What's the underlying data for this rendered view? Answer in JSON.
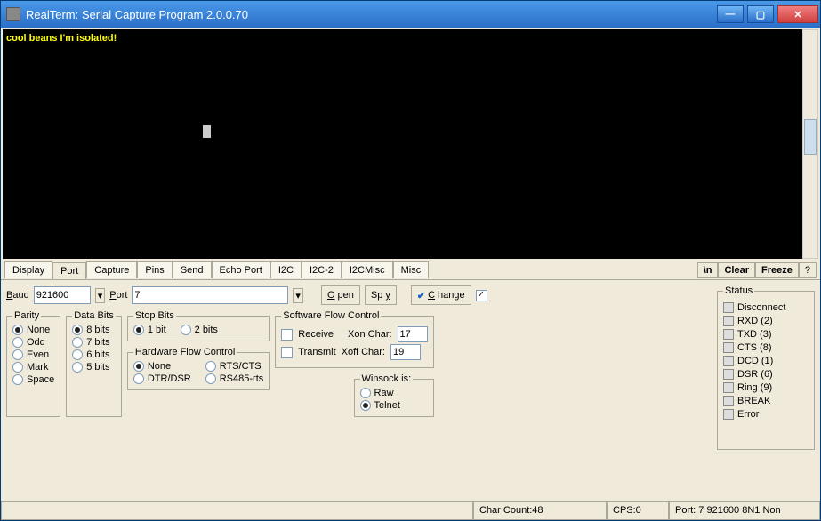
{
  "window": {
    "title": "RealTerm: Serial Capture Program 2.0.0.70"
  },
  "terminal": {
    "text": "cool beans I'm isolated!"
  },
  "tabs": [
    "Display",
    "Port",
    "Capture",
    "Pins",
    "Send",
    "Echo Port",
    "I2C",
    "I2C-2",
    "I2CMisc",
    "Misc"
  ],
  "active_tab": "Port",
  "right_buttons": {
    "nl": "\\n",
    "clear": "Clear",
    "freeze": "Freeze",
    "help": "?"
  },
  "port": {
    "baud_label": "Baud",
    "baud_value": "921600",
    "port_label": "Port",
    "port_value": "7",
    "open": "Open",
    "spy": "Spy",
    "change": "Change"
  },
  "parity": {
    "legend": "Parity",
    "options": [
      "None",
      "Odd",
      "Even",
      "Mark",
      "Space"
    ],
    "selected": "None"
  },
  "databits": {
    "legend": "Data Bits",
    "options": [
      "8 bits",
      "7 bits",
      "6 bits",
      "5 bits"
    ],
    "selected": "8 bits"
  },
  "stopbits": {
    "legend": "Stop Bits",
    "options": [
      "1 bit",
      "2 bits"
    ],
    "selected": "1 bit"
  },
  "hwflow": {
    "legend": "Hardware Flow Control",
    "options": [
      "None",
      "RTS/CTS",
      "DTR/DSR",
      "RS485-rts"
    ],
    "selected": "None"
  },
  "swflow": {
    "legend": "Software Flow Control",
    "receive_label": "Receive",
    "xon_label": "Xon Char:",
    "xon_value": "17",
    "transmit_label": "Transmit",
    "xoff_label": "Xoff Char:",
    "xoff_value": "19"
  },
  "winsock": {
    "legend": "Winsock is:",
    "options": [
      "Raw",
      "Telnet"
    ],
    "selected": "Telnet"
  },
  "status": {
    "legend": "Status",
    "items": [
      "Disconnect",
      "RXD (2)",
      "TXD (3)",
      "CTS (8)",
      "DCD (1)",
      "DSR (6)",
      "Ring (9)",
      "BREAK",
      "Error"
    ]
  },
  "statusbar": {
    "charcount": "Char Count:48",
    "cps": "CPS:0",
    "port": "Port: 7 921600 8N1 Non"
  }
}
